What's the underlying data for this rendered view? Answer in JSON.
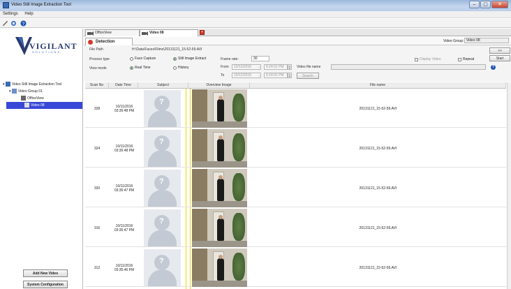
{
  "window": {
    "title": "Video Still Image Extraction Tool",
    "controls": [
      "–",
      "▢",
      "✕"
    ]
  },
  "menu": [
    "Settings",
    "Help"
  ],
  "toolbar": {
    "icons": [
      "tools-icon",
      "gear-icon",
      "help-icon"
    ]
  },
  "logo": {
    "word": "VIGILANT",
    "sub": "SOLUTIONS"
  },
  "tree": [
    {
      "label": "Video Still Image Extraction Tool",
      "level": 0
    },
    {
      "label": "Video Group 01",
      "level": 1
    },
    {
      "label": "OfficeView",
      "level": 2
    },
    {
      "label": "Video 08",
      "level": 2,
      "selected": true
    }
  ],
  "sidebar_buttons": {
    "add": "Add New Video",
    "config": "System Configuration"
  },
  "tabs": [
    {
      "label": "OfficeView"
    },
    {
      "label": "Video 08",
      "active": true
    }
  ],
  "detection_tab": "Detection",
  "video_group": {
    "label": "Video Group:",
    "value": "Video 08"
  },
  "form": {
    "file_path_label": "File Path",
    "file_path": "H:\\Data\\Faces\\Films\\20131121_15-52-59.AVI",
    "process_type_label": "Process type",
    "face_capture": "Face Capture",
    "still_image": "Still Image Extract",
    "view_mode_label": "View mode",
    "real_time": "Real Time",
    "history": "History",
    "frame_rate_label": "Frame rate:",
    "frame_rate": "30",
    "from_label": "From",
    "to_label": "To",
    "from_date": "10/12/2016",
    "from_time": "6:24:01 PM",
    "to_date": "10/12/2016",
    "to_time": "6:24:01 PM",
    "video_file_name_label": "Video file name",
    "search": "Search",
    "display_video": "Display Video",
    "repeat": "Repeat",
    "btn_more": ">>",
    "btn_start": "Start"
  },
  "grid": {
    "headers": [
      "Scan No",
      "Date Time",
      "Subject",
      "Overview Image",
      "File name"
    ],
    "rows": [
      {
        "scan": "328",
        "date": "10/11/2016",
        "time": "03:35:48 PM",
        "file": "20131121_15-52-59.AVI"
      },
      {
        "scan": "324",
        "date": "10/11/2016",
        "time": "03:35:48 PM",
        "file": "20131121_15-52-59.AVI"
      },
      {
        "scan": "320",
        "date": "10/11/2016",
        "time": "03:35:47 PM",
        "file": "20131121_15-52-59.AVI"
      },
      {
        "scan": "316",
        "date": "10/11/2016",
        "time": "03:35:47 PM",
        "file": "20131121_15-52-59.AVI"
      },
      {
        "scan": "312",
        "date": "10/11/2016",
        "time": "03:35:46 PM",
        "file": "20131121_15-52-59.AVI"
      }
    ]
  }
}
